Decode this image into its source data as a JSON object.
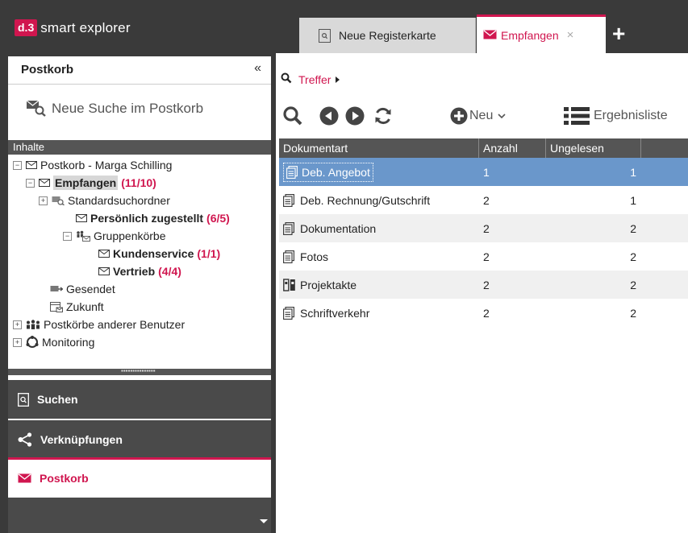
{
  "app": {
    "logo_mark": "d.3",
    "logo_text": "smart explorer"
  },
  "tabs": [
    {
      "label": "Neue Registerkarte",
      "icon": "search-doc-icon"
    },
    {
      "label": "Empfangen",
      "icon": "envelope-icon",
      "close": "×"
    }
  ],
  "tab_add": "+",
  "sidebar": {
    "title": "Postkorb",
    "collapse": "«",
    "search_label": "Neue Suche im Postkorb",
    "section": "Inhalte",
    "tree": [
      {
        "label": "Postkorb - Marga Schilling"
      },
      {
        "label": "Empfangen",
        "count": "(11/10)"
      },
      {
        "label": "Standardsuchordner"
      },
      {
        "label": "Persönlich zugestellt",
        "count": "(6/5)"
      },
      {
        "label": "Gruppenkörbe"
      },
      {
        "label": "Kundenservice",
        "count": "(1/1)"
      },
      {
        "label": "Vertrieb",
        "count": "(4/4)"
      },
      {
        "label": "Gesendet"
      },
      {
        "label": "Zukunft"
      },
      {
        "label": "Postkörbe anderer Benutzer"
      },
      {
        "label": "Monitoring"
      }
    ],
    "nav": [
      {
        "label": "Suchen"
      },
      {
        "label": "Verknüpfungen"
      },
      {
        "label": "Postkorb"
      }
    ]
  },
  "content": {
    "breadcrumb": "Treffer",
    "toolbar": {
      "new_label": "Neu",
      "results_label": "Ergebnisliste"
    },
    "columns": [
      "Dokumentart",
      "Anzahl",
      "Ungelesen"
    ],
    "rows": [
      {
        "name": "Deb. Angebot",
        "count": "1",
        "unread": "1"
      },
      {
        "name": "Deb. Rechnung/Gutschrift",
        "count": "2",
        "unread": "1"
      },
      {
        "name": "Dokumentation",
        "count": "2",
        "unread": "2"
      },
      {
        "name": "Fotos",
        "count": "2",
        "unread": "2"
      },
      {
        "name": "Projektakte",
        "count": "2",
        "unread": "2"
      },
      {
        "name": "Schriftverkehr",
        "count": "2",
        "unread": "2"
      }
    ]
  },
  "colors": {
    "accent": "#d0164f",
    "dark": "#3a3a3a",
    "selection": "#6a97cb"
  }
}
